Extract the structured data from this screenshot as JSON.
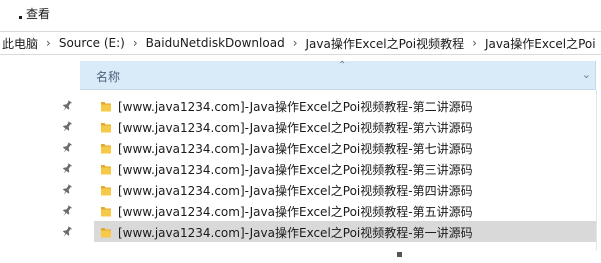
{
  "ribbon": {
    "view_label": "查看"
  },
  "address": {
    "crumbs": [
      "此电脑",
      "Source (E:)",
      "BaiduNetdiskDownload",
      "Java操作Excel之Poi视频教程",
      "Java操作Excel之Poi"
    ],
    "separator": "›"
  },
  "columns": {
    "name_label": "名称",
    "sort_glyph": "⌃",
    "expand_glyph": "⌄"
  },
  "files": [
    "[www.java1234.com]-Java操作Excel之Poi视频教程-第二讲源码",
    "[www.java1234.com]-Java操作Excel之Poi视频教程-第六讲源码",
    "[www.java1234.com]-Java操作Excel之Poi视频教程-第七讲源码",
    "[www.java1234.com]-Java操作Excel之Poi视频教程-第三讲源码",
    "[www.java1234.com]-Java操作Excel之Poi视频教程-第四讲源码",
    "[www.java1234.com]-Java操作Excel之Poi视频教程-第五讲源码",
    "[www.java1234.com]-Java操作Excel之Poi视频教程-第一讲源码"
  ],
  "selected_index": 6,
  "colors": {
    "folder": "#f7c948",
    "folder_dark": "#e3a92b",
    "header_bg": "#d9ebf9",
    "selected_bg": "#d9d9d9",
    "pin": "#6b6b6b"
  },
  "icons": {
    "folder": "folder-icon",
    "pin": "pin-icon"
  }
}
